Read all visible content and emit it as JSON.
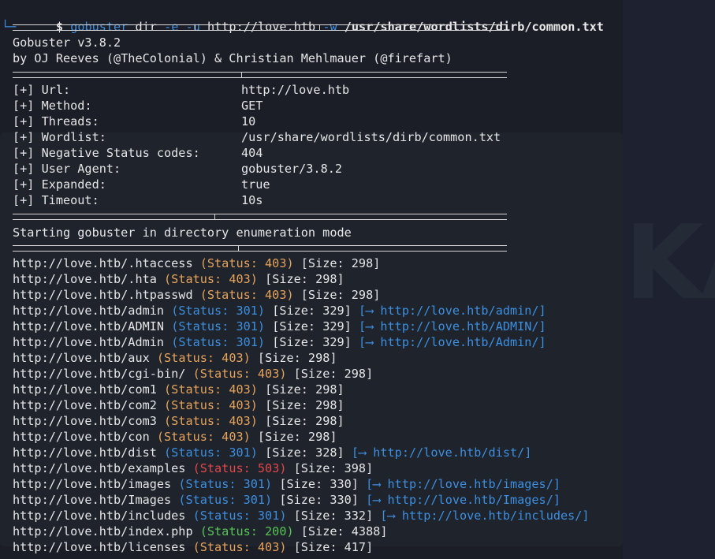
{
  "prompt": {
    "corner": "└─",
    "dollar": "$",
    "command": "gobuster",
    "subcommand": "dir",
    "flag_e": "-e",
    "flag_u": "-u",
    "url": "http://love.htb",
    "flag_w": "-w",
    "wordlist": "/usr/share/wordlists/dirb/common.txt"
  },
  "banner": {
    "version": "Gobuster v3.8.2",
    "authors": "by OJ Reeves (@TheColonial) & Christian Mehlmauer (@firefart)"
  },
  "config": [
    {
      "key": "[+] Url:",
      "value": "http://love.htb"
    },
    {
      "key": "[+] Method:",
      "value": "GET"
    },
    {
      "key": "[+] Threads:",
      "value": "10"
    },
    {
      "key": "[+] Wordlist:",
      "value": "/usr/share/wordlists/dirb/common.txt"
    },
    {
      "key": "[+] Negative Status codes:",
      "value": "404"
    },
    {
      "key": "[+] User Agent:",
      "value": "gobuster/3.8.2"
    },
    {
      "key": "[+] Expanded:",
      "value": "true"
    },
    {
      "key": "[+] Timeout:",
      "value": "10s"
    }
  ],
  "mode_line": "Starting gobuster in directory enumeration mode",
  "results": [
    {
      "url": "http://love.htb/.htaccess",
      "status": "(Status: 403)",
      "code": "403",
      "size": "[Size: 298]",
      "redirect": ""
    },
    {
      "url": "http://love.htb/.hta",
      "status": "(Status: 403)",
      "code": "403",
      "size": "[Size: 298]",
      "redirect": ""
    },
    {
      "url": "http://love.htb/.htpasswd",
      "status": "(Status: 403)",
      "code": "403",
      "size": "[Size: 298]",
      "redirect": ""
    },
    {
      "url": "http://love.htb/admin",
      "status": "(Status: 301)",
      "code": "301",
      "size": "[Size: 329]",
      "redirect": "[⟶ http://love.htb/admin/]"
    },
    {
      "url": "http://love.htb/ADMIN",
      "status": "(Status: 301)",
      "code": "301",
      "size": "[Size: 329]",
      "redirect": "[⟶ http://love.htb/ADMIN/]"
    },
    {
      "url": "http://love.htb/Admin",
      "status": "(Status: 301)",
      "code": "301",
      "size": "[Size: 329]",
      "redirect": "[⟶ http://love.htb/Admin/]"
    },
    {
      "url": "http://love.htb/aux",
      "status": "(Status: 403)",
      "code": "403",
      "size": "[Size: 298]",
      "redirect": ""
    },
    {
      "url": "http://love.htb/cgi-bin/",
      "status": "(Status: 403)",
      "code": "403",
      "size": "[Size: 298]",
      "redirect": ""
    },
    {
      "url": "http://love.htb/com1",
      "status": "(Status: 403)",
      "code": "403",
      "size": "[Size: 298]",
      "redirect": ""
    },
    {
      "url": "http://love.htb/com2",
      "status": "(Status: 403)",
      "code": "403",
      "size": "[Size: 298]",
      "redirect": ""
    },
    {
      "url": "http://love.htb/com3",
      "status": "(Status: 403)",
      "code": "403",
      "size": "[Size: 298]",
      "redirect": ""
    },
    {
      "url": "http://love.htb/con",
      "status": "(Status: 403)",
      "code": "403",
      "size": "[Size: 298]",
      "redirect": ""
    },
    {
      "url": "http://love.htb/dist",
      "status": "(Status: 301)",
      "code": "301",
      "size": "[Size: 328]",
      "redirect": "[⟶ http://love.htb/dist/]"
    },
    {
      "url": "http://love.htb/examples",
      "status": "(Status: 503)",
      "code": "503",
      "size": "[Size: 398]",
      "redirect": ""
    },
    {
      "url": "http://love.htb/images",
      "status": "(Status: 301)",
      "code": "301",
      "size": "[Size: 330]",
      "redirect": "[⟶ http://love.htb/images/]"
    },
    {
      "url": "http://love.htb/Images",
      "status": "(Status: 301)",
      "code": "301",
      "size": "[Size: 330]",
      "redirect": "[⟶ http://love.htb/Images/]"
    },
    {
      "url": "http://love.htb/includes",
      "status": "(Status: 301)",
      "code": "301",
      "size": "[Size: 332]",
      "redirect": "[⟶ http://love.htb/includes/]"
    },
    {
      "url": "http://love.htb/index.php",
      "status": "(Status: 200)",
      "code": "200",
      "size": "[Size: 4388]",
      "redirect": ""
    },
    {
      "url": "http://love.htb/licenses",
      "status": "(Status: 403)",
      "code": "403",
      "size": "[Size: 417]",
      "redirect": ""
    }
  ],
  "colors": {
    "background": "#1b1e27",
    "text": "#e6e6e6",
    "accent_blue": "#3d8fe0",
    "status_403": "#e7a35a",
    "status_301": "#3d8fe0",
    "status_503": "#e3474a",
    "status_200": "#57c454"
  }
}
